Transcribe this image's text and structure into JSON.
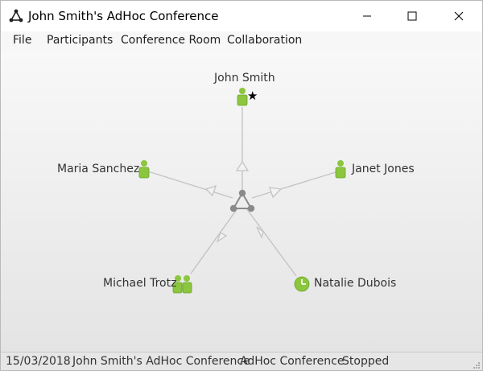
{
  "window": {
    "title": "John Smith's AdHoc Conference",
    "controls": [
      "minimize",
      "maximize",
      "close"
    ]
  },
  "menu": {
    "items": [
      "File",
      "Participants",
      "Conference Room",
      "Collaboration"
    ]
  },
  "conference": {
    "hub_icon": "conference-hub-icon",
    "participants": [
      {
        "name": "John Smith",
        "icon": "person-icon",
        "badge": "star-icon",
        "role": "host"
      },
      {
        "name": "Janet Jones",
        "icon": "person-icon"
      },
      {
        "name": "Natalie Dubois",
        "icon": "clock-icon"
      },
      {
        "name": "Michael Trotz",
        "icon": "group-icon"
      },
      {
        "name": "Maria Sanchez",
        "icon": "person-icon"
      }
    ]
  },
  "statusbar": {
    "date": "15/03/2018",
    "conference_name": "John Smith's AdHoc Conference",
    "type": "AdHoc Conference",
    "state": "Stopped"
  },
  "colors": {
    "person_green": "#8cc63e",
    "person_green_dark": "#6aa52a",
    "link_gray": "#c4c4c4",
    "hub_gray": "#8a8a8a"
  }
}
